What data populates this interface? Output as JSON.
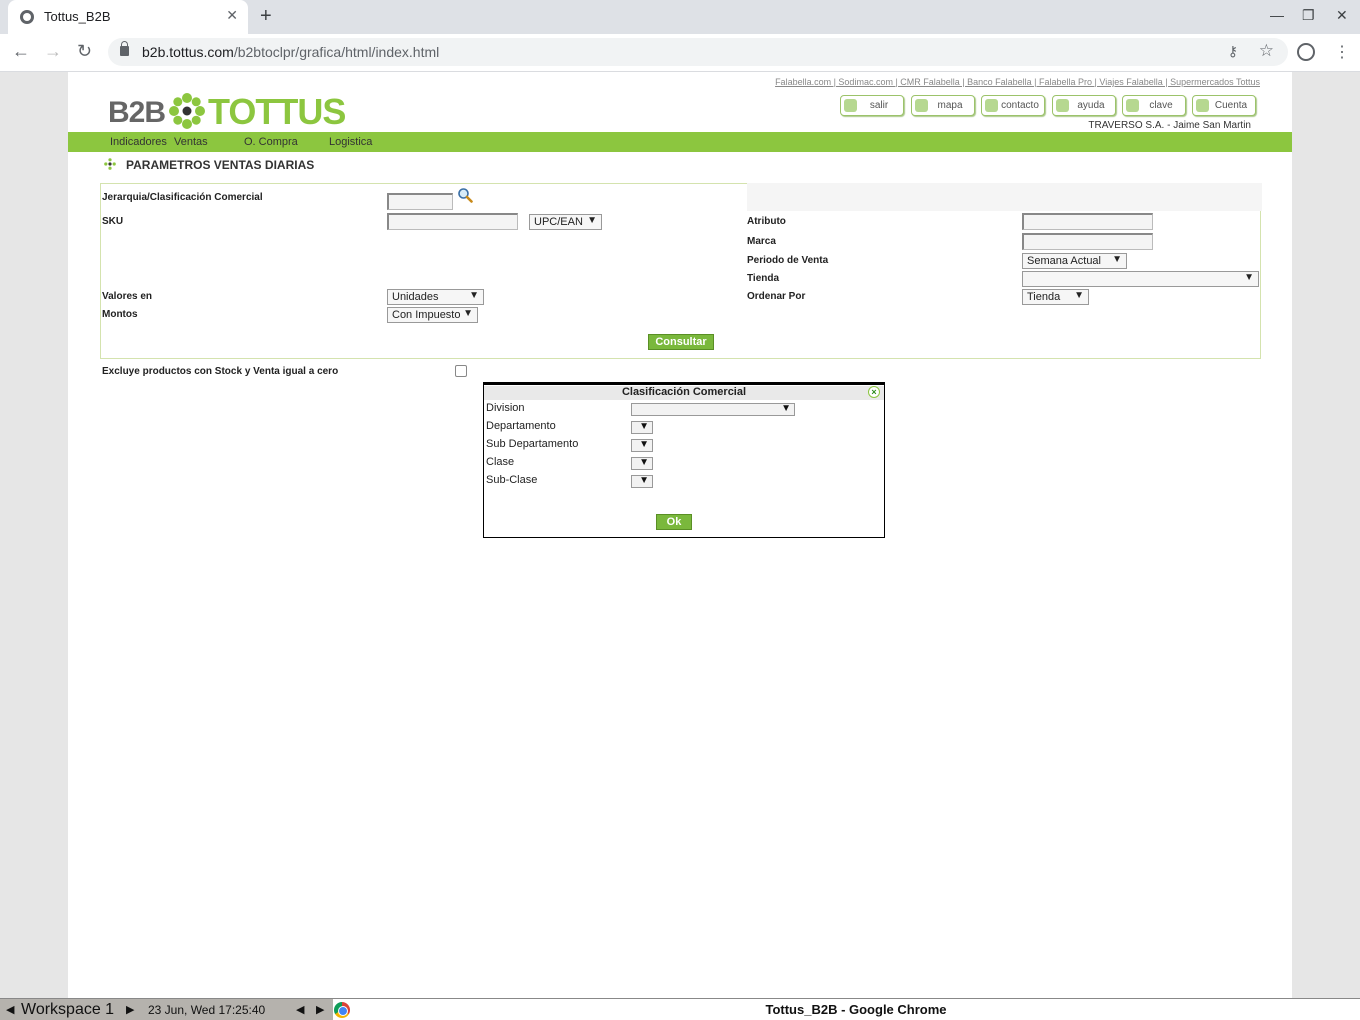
{
  "browser": {
    "tab_title": "Tottus_B2B",
    "url_host": "b2b.tottus.com",
    "url_path": "/b2btoclpr/grafica/html/index.html"
  },
  "header": {
    "top_links": "Falabella.com | Sodimac.com | CMR Falabella | Banco Falabella | Falabella Pro | Viajes Falabella | Supermercados Tottus",
    "logo_b2b": "B2B",
    "logo_brand": "TOTTUS",
    "buttons": [
      "salir",
      "mapa",
      "contacto",
      "ayuda",
      "clave",
      "Cuenta"
    ],
    "user": "TRAVERSO S.A. - Jaime San Martin"
  },
  "nav": {
    "items": [
      "Indicadores",
      "Ventas",
      "O. Compra",
      "Logistica"
    ]
  },
  "section_title": "PARAMETROS VENTAS DIARIAS",
  "form": {
    "jerarquia_label": "Jerarquia/Clasificación Comercial",
    "sku_label": "SKU",
    "sku_type": "UPC/EAN",
    "atributo_label": "Atributo",
    "marca_label": "Marca",
    "periodo_label": "Periodo de Venta",
    "periodo_value": "Semana Actual",
    "tienda_label": "Tienda",
    "tienda_value": "",
    "valores_label": "Valores en",
    "valores_value": "Unidades",
    "ordenar_label": "Ordenar Por",
    "ordenar_value": "Tienda",
    "montos_label": "Montos",
    "montos_value": "Con Impuesto",
    "consultar": "Consultar"
  },
  "exclude_label": "Excluye productos con Stock y Venta igual a cero",
  "modal": {
    "title": "Clasificación Comercial",
    "close": "×",
    "fields": [
      "Division",
      "Departamento",
      "Sub Departamento",
      "Clase",
      "Sub-Clase"
    ],
    "ok": "Ok"
  },
  "taskbar": {
    "workspace": "Workspace 1",
    "clock": "23 Jun, Wed 17:25:40",
    "window_title": "Tottus_B2B - Google Chrome"
  }
}
